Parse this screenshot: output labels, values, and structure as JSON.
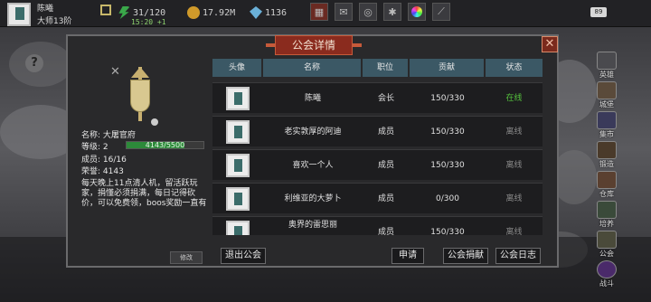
{
  "topbar": {
    "player_name": "陈曦",
    "player_level": "大师13阶",
    "stamina": "31/120",
    "stamina_timer": "15:20 +1",
    "gold": "17.92M",
    "gems": "1136",
    "badge": "89",
    "icons": [
      "shop-icon",
      "mail-icon",
      "gamepad-icon",
      "settings-gear-icon",
      "color-wheel-icon",
      "sword-icon"
    ]
  },
  "sidebar": {
    "items": [
      {
        "icon": "leaderboard-icon",
        "label": "英雄"
      },
      {
        "icon": "dungeon-icon",
        "label": "城堡"
      },
      {
        "icon": "market-icon",
        "label": "集市"
      },
      {
        "icon": "forge-icon",
        "label": "锻造"
      },
      {
        "icon": "warehouse-icon",
        "label": "仓库"
      },
      {
        "icon": "cultivate-icon",
        "label": "培养"
      },
      {
        "icon": "guild-icon",
        "label": "公会"
      },
      {
        "icon": "battle-icon",
        "label": "战斗"
      }
    ]
  },
  "dialog": {
    "title": "公会详情",
    "guild": {
      "name_label": "名称:",
      "name": "大屠官府",
      "level_label": "等级:",
      "level": "2",
      "xp_text": "4143/5500",
      "xp_progress": 0.753,
      "members_label": "成员:",
      "members": "16/16",
      "honor_label": "荣誉:",
      "honor": "4143",
      "description": "每天晚上11点清人机，留活跃玩家，捐懂必须捐满，每日记得砍价，可以免费领，boos奖励一直有",
      "modify_label": "修改"
    },
    "columns": [
      "头像",
      "名称",
      "职位",
      "贡献",
      "状态"
    ],
    "members": [
      {
        "name": "陈曦",
        "position": "会长",
        "contribution": "150/330",
        "status": "在线",
        "online": true
      },
      {
        "name": "老实敦厚的阿迪",
        "position": "成员",
        "contribution": "150/330",
        "status": "离线",
        "online": false
      },
      {
        "name": "喜欢一个人",
        "position": "成员",
        "contribution": "150/330",
        "status": "离线",
        "online": false
      },
      {
        "name": "利维亚的大萝卜",
        "position": "成员",
        "contribution": "0/300",
        "status": "离线",
        "online": false
      },
      {
        "name": "奥界的雷思丽",
        "position": "成员",
        "contribution": "150/330",
        "status": "离线",
        "online": false
      }
    ],
    "buttons": {
      "leave": "退出公会",
      "apply": "申请",
      "donate": "公会捐献",
      "log": "公会日志"
    }
  }
}
